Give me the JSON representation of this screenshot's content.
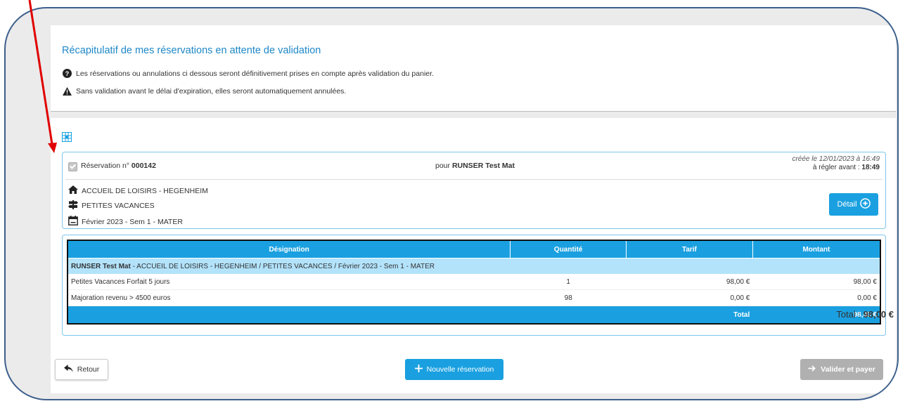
{
  "summary": {
    "title": "Récapitulatif de mes réservations en attente de validation",
    "note_info": "Les réservations ou annulations ci dessous seront définitivement prises en compte après validation du panier.",
    "note_warning": "Sans validation avant le délai d'expiration, elles seront automatiquement annulées."
  },
  "reservation": {
    "number_label": "Réservation n°",
    "number": "000142",
    "for_label": "pour",
    "for_name": "RUNSER Test Mat",
    "created": "créée le 12/01/2023 à 16:49",
    "deadline_label": "à régler avant :",
    "deadline_time": "18:49",
    "center": "ACCUEIL DE LOISIRS - HEGENHEIM",
    "activity_type": "PETITES VACANCES",
    "period": "Février 2023 - Sem 1 - MATER",
    "detail_button": "Détail"
  },
  "table": {
    "headers": {
      "designation": "Désignation",
      "quantity": "Quantité",
      "rate": "Tarif",
      "amount": "Montant"
    },
    "group": {
      "name": "RUNSER Test Mat",
      "desc": "- ACCUEIL DE LOISIRS - HEGENHEIM / PETITES VACANCES / Février 2023 - Sem 1 - MATER"
    },
    "rows": [
      {
        "designation": "Petites Vacances Forfait 5 jours",
        "quantity": "1",
        "rate": "98,00 €",
        "amount": "98,00 €"
      },
      {
        "designation": "Majoration revenu > 4500 euros",
        "quantity": "98",
        "rate": "0,00 €",
        "amount": "0,00 €"
      }
    ],
    "total_label": "Total",
    "total_value": "98,00 €"
  },
  "footer": {
    "total_label": "Total :",
    "total_value": "98,00 €",
    "back_button": "Retour",
    "new_button": "Nouvelle réservation",
    "validate_button": "Valider et payer"
  },
  "colors": {
    "accent": "#1aa0e0",
    "title_blue": "#1e88c8",
    "group_row": "#b3e3fb",
    "disabled_button": "#b0b0b0",
    "annotation_arrow": "#e00000",
    "frame_border": "#3d5f8c"
  },
  "icons": {
    "info": "question-circle-icon",
    "warning": "warning-triangle-icon",
    "table": "grid-icon",
    "center": "house-icon",
    "activity": "signpost-icon",
    "period": "calendar-icon",
    "detail": "plus-circle-icon",
    "back": "reply-arrow-icon",
    "new": "plus-icon",
    "validate": "arrow-right-icon"
  }
}
